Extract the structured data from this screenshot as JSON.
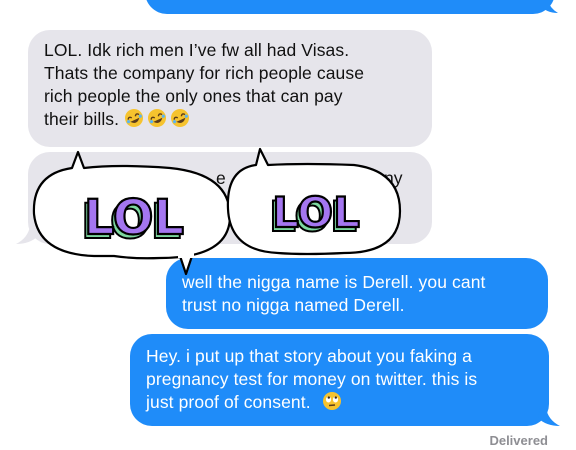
{
  "conversation": {
    "messages": [
      {
        "sender": "them",
        "text": "LOL. Idk rich men I’ve fw all had Visas. Thats the company for rich people cause rich people the only ones that can pay their bills.",
        "lines": [
          "LOL. Idk rich men I’ve fw all had Visas.",
          "Thats the company for rich people cause",
          "rich people the only ones that can pay",
          "their bills."
        ],
        "emojis": [
          "rofl-emoji",
          "rofl-emoji",
          "rofl-emoji"
        ]
      },
      {
        "sender": "them",
        "partial_fragments": [
          "e",
          "ny"
        ]
      },
      {
        "sender": "me",
        "lines": [
          "well the nigga name is Derell. you cant",
          "trust no nigga named Derell."
        ]
      },
      {
        "sender": "me",
        "lines": [
          "Hey. i put up that story about you faking a",
          "pregnancy test for money on twitter. this is",
          "just proof of consent."
        ],
        "emojis": [
          "eye-roll-emoji"
        ]
      }
    ],
    "status": "Delivered"
  },
  "stickers": [
    {
      "text": "LOL",
      "color_fill": "#a476f0",
      "color_shadow": "#7dd8a0"
    },
    {
      "text": "LOL",
      "color_fill": "#a476f0",
      "color_shadow": "#7dd8a0"
    }
  ],
  "colors": {
    "incoming_bubble": "#e6e5eb",
    "outgoing_bubble": "#1f8cf9",
    "delivered_text": "#8e8e93"
  }
}
